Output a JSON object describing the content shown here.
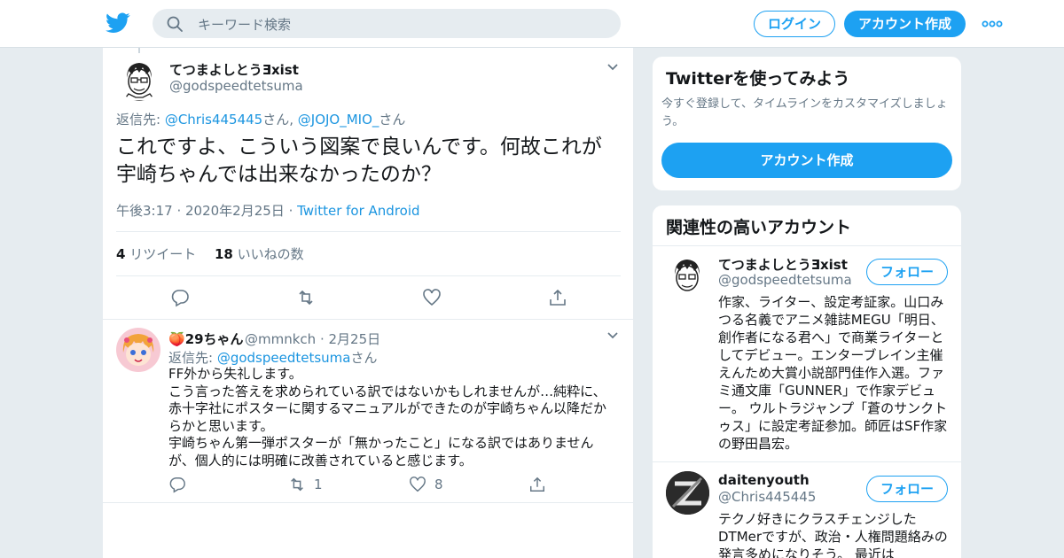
{
  "header": {
    "search_placeholder": "キーワード検索",
    "login_label": "ログイン",
    "signup_label": "アカウント作成",
    "brand_color": "#1da1f2"
  },
  "tweet": {
    "author_name": "てつまよしとうƎxist",
    "author_handle": "@godspeedtetsuma",
    "reply_prefix": "返信先: ",
    "reply_to_1": "@Chris445445",
    "reply_suffix_1": "さん, ",
    "reply_to_2": "@JOJO_MIO_",
    "reply_suffix_2": "さん",
    "text": "これですよ、こういう図案で良いんです。何故これが宇崎ちゃんでは出来なかったのか？",
    "timestamp": "午後3:17 · 2020年2月25日",
    "separator": " · ",
    "source": "Twitter for Android",
    "retweet_count": "4",
    "retweet_label": " リツイート",
    "like_count": "18",
    "like_label": " いいねの数"
  },
  "reply": {
    "emoji": "🍑",
    "author_name": "29ちゃん",
    "author_handle": "@mmnkch",
    "date": " · 2月25日",
    "reply_prefix": "返信先: ",
    "reply_to": "@godspeedtetsuma",
    "reply_suffix": "さん",
    "text_lines": [
      "FF外から失礼します。",
      "こう言った答えを求められている訳ではないかもしれませんが…純粋に、",
      "赤十字社にポスターに関するマニュアルができたのが宇崎ちゃん以降だか",
      "らかと思います。",
      "宇崎ちゃん第一弾ポスターが「無かったこと」になる訳ではありません",
      "が、個人的には明確に改善されていると感じます。"
    ],
    "retweet_count": "1",
    "like_count": "8"
  },
  "signup_card": {
    "title": "Twitterを使ってみよう",
    "subtitle_lines": [
      "今すぐ登録して、タイムラインをカスタマイズしましょ",
      "う。"
    ],
    "button_label": "アカウント作成"
  },
  "related_card": {
    "title": "関連性の高いアカウント",
    "accounts": [
      {
        "name": "てつまよしとうƎxist",
        "handle": "@godspeedtetsuma",
        "follow_label": "フォロー",
        "bio_lines": [
          "作家、ライター、設定考証家。山口み",
          "つる名義でアニメ雑誌MEGU「明日、",
          "創作者になる君へ」で商業ライターと",
          "してデビュー。エンターブレイン主催",
          "えんため大賞小説部門佳作入選。ファ",
          "ミ通文庫「GUNNER」で作家デビュ",
          "ー。 ウルトラジャンプ「蒼のサンクト",
          "ゥス」に設定考証参加。師匠はSF作家",
          "の野田昌宏。"
        ]
      },
      {
        "name": "daitenyouth",
        "handle": "@Chris445445",
        "follow_label": "フォロー",
        "bio_lines": [
          "テクノ好きにクラスチェンジした",
          "DTMerですが、政治・人権問題絡みの",
          "発言多めになりそう。 最近は"
        ]
      }
    ]
  }
}
